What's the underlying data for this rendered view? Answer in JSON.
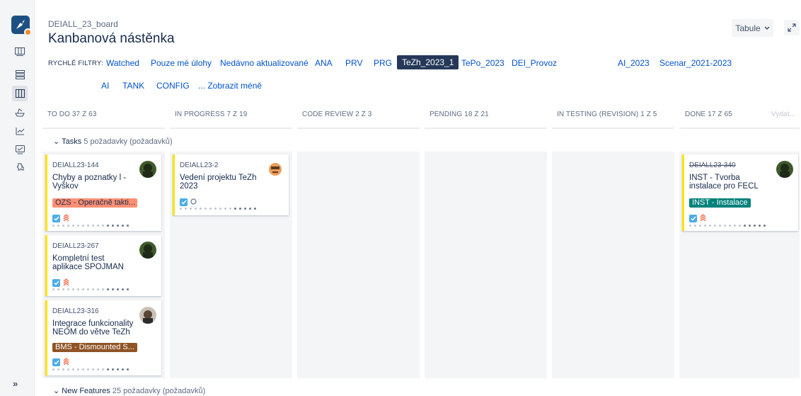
{
  "board": {
    "breadcrumb": "DEIALL_23_board",
    "title": "Kanbanová nástěnka",
    "view_button": "Tabule"
  },
  "quick_filters": {
    "label": "RYCHLÉ FILTRY:",
    "items": [
      "Watched",
      "Pouze mé úlohy",
      "Nedávno aktualizované",
      "ANA",
      "PRV",
      "PRG",
      "TeZh_2023_1",
      "TePo_2023",
      "DEI_Provoz",
      "AI_2023",
      "Scenar_2021-2023",
      "AI",
      "TANK",
      "CONFIG",
      "... Zobrazit méně"
    ],
    "active": "TeZh_2023_1"
  },
  "columns": [
    {
      "name": "TO DO",
      "count": "37 Z 63"
    },
    {
      "name": "IN PROGRESS",
      "count": "7 Z 19"
    },
    {
      "name": "CODE REVIEW",
      "count": "2 Z 3"
    },
    {
      "name": "PENDING",
      "count": "18 Z 21"
    },
    {
      "name": "IN TESTING (REVISION)",
      "count": "1 Z 5"
    },
    {
      "name": "DONE",
      "count": "17 Z 65"
    }
  ],
  "release_link": "Vydat...",
  "swimlanes": [
    {
      "name": "Tasks",
      "count": "5 požadavky (požadavků)"
    },
    {
      "name": "New Features",
      "count": "25 požadavky (požadavků)"
    }
  ],
  "cards": [
    {
      "key": "DEIALL23-144",
      "summary": "Chyby a poznatky l - Vyškov",
      "epic": "OZS - Operačně takti...",
      "epic_color": "#ff8f73",
      "epic_text_color": "#172b4d",
      "avatar": "avatar-dark"
    },
    {
      "key": "DEIALL23-267",
      "summary": "Kompletní test aplikace SPOJMAN",
      "avatar": "avatar-dark"
    },
    {
      "key": "DEIALL23-316",
      "summary": "Integrace funkcionality NEOM do větve TeZh",
      "epic": "BMS - Dismounted S...",
      "epic_color": "#8f5325",
      "epic_text_color": "#ffffff",
      "avatar": "avatar-photo"
    },
    {
      "key": "DEIALL23-2",
      "summary": "Vedení projektu TeZh 2023",
      "avatar": "avatar-cartoon"
    },
    {
      "key": "DEIALL23-340",
      "summary": "INST - Tvorba instalace pro FECL",
      "epic": "INST - Instalace",
      "epic_color": "#00827b",
      "epic_text_color": "#ffffff",
      "avatar": "avatar-dark",
      "done": true
    }
  ],
  "colors": {
    "accent": "#0052cc",
    "active_filter": "#253858",
    "card_border": "#ffe400"
  }
}
